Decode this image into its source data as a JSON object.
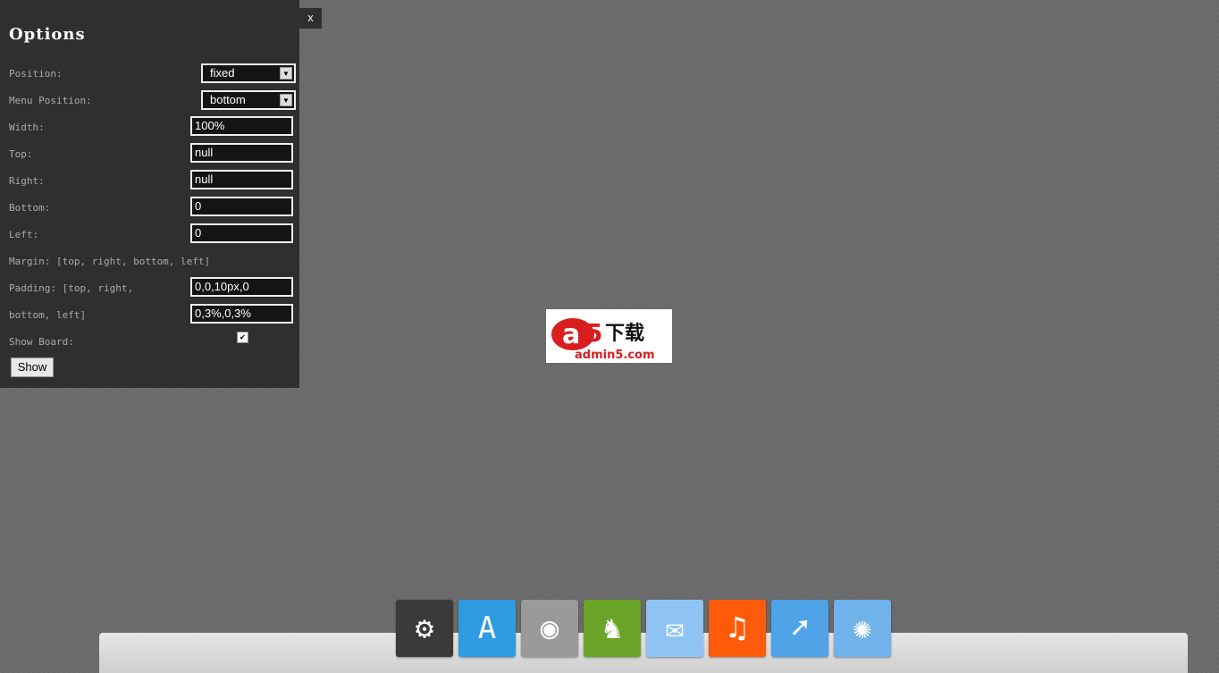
{
  "options": {
    "title": "Options",
    "close_label": "x",
    "position": {
      "label": "Position:",
      "value": "fixed"
    },
    "menu_position": {
      "label": "Menu Position:",
      "value": "bottom"
    },
    "width": {
      "label": "Width:",
      "value": "100%"
    },
    "top": {
      "label": "Top:",
      "value": "null"
    },
    "right": {
      "label": "Right:",
      "value": "null"
    },
    "bottom": {
      "label": "Bottom:",
      "value": "0"
    },
    "left": {
      "label": "Left:",
      "value": "0"
    },
    "margin": {
      "label": "Margin: [top, right, bottom, left]"
    },
    "padding": {
      "label1": "Padding: [top, right,",
      "label2": "bottom, left]",
      "value1": "0,0,10px,0",
      "value2": "0,3%,0,3%"
    },
    "show_board": {
      "label": "Show Board:",
      "checked": true
    },
    "show_button": "Show"
  },
  "logo": {
    "text": "a5下载",
    "sub": "admin5.com"
  },
  "dock": [
    {
      "name": "system-preferences",
      "icon": "⚙",
      "color": "#3a3a3a"
    },
    {
      "name": "app-store",
      "icon": "A",
      "color": "#2f9be0"
    },
    {
      "name": "photo-booth",
      "icon": "◉",
      "color": "#9a9a9a"
    },
    {
      "name": "game-center",
      "icon": "♞",
      "color": "#6aa52a"
    },
    {
      "name": "mail",
      "icon": "✉",
      "color": "#8fc4f2"
    },
    {
      "name": "itunes",
      "icon": "♫",
      "color": "#ff5a0a"
    },
    {
      "name": "safari",
      "icon": "➚",
      "color": "#4fa3e6"
    },
    {
      "name": "iphoto",
      "icon": "✺",
      "color": "#6fb3ea"
    }
  ]
}
